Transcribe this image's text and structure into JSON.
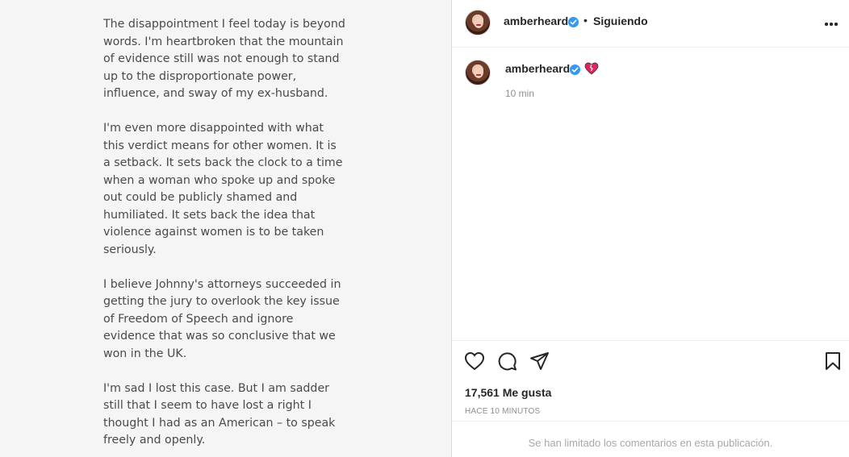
{
  "post": {
    "statement_paragraphs": [
      "The disappointment I feel today is beyond words. I'm heartbroken that the mountain of evidence still was not enough to stand up to the disproportionate power, influence, and sway of my ex-husband.",
      "I'm even more disappointed with what this verdict means for other women. It is a setback. It sets back the clock to a time when a woman who spoke up and spoke out could be publicly shamed and humiliated. It sets back the idea that violence against women is to be taken seriously.",
      "I believe Johnny's attorneys succeeded in getting the jury to overlook the key issue of Freedom of Speech and ignore evidence that was so conclusive that we won in the UK.",
      "I'm sad I lost this case. But I am sadder still that I seem to have lost a right I thought I had as an American – to speak freely and openly."
    ]
  },
  "header": {
    "username": "amberheard",
    "separator": "•",
    "follow_status": "Siguiendo",
    "more_icon": "more-horizontal-icon"
  },
  "caption": {
    "username": "amberheard",
    "emoji": "heart-emoji",
    "time": "10 min"
  },
  "actions": {
    "likes": "17,561 Me gusta",
    "timestamp": "HACE 10 MINUTOS",
    "comments_limited": "Se han limitado los comentarios en esta publicación."
  },
  "colors": {
    "verified": "#3897f0",
    "heart_emoji": "#e0245e",
    "muted_text": "#8e8e8e"
  }
}
